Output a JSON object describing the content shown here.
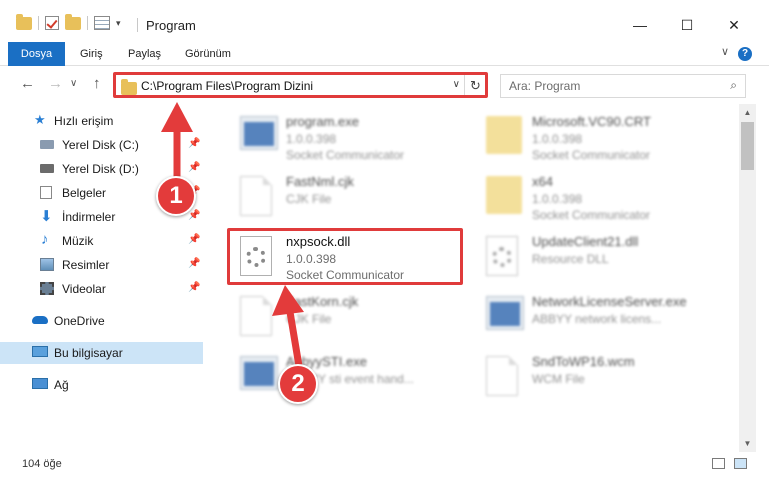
{
  "window": {
    "title": "Program",
    "minimize": "—",
    "maximize": "☐",
    "close": "✕"
  },
  "ribbon": {
    "tabs": [
      "Dosya",
      "Giriş",
      "Paylaş",
      "Görünüm"
    ],
    "help": "?",
    "expand": "∨"
  },
  "nav": {
    "back": "←",
    "forward": "→",
    "up": "↑",
    "recent": "∨",
    "address": "C:\\Program Files\\Program Dizini",
    "address_dropdown": "∨",
    "refresh": "↻",
    "search_placeholder": "Ara: Program",
    "search_icon": "⌕"
  },
  "sidebar": {
    "items": [
      {
        "label": "Hızlı erişim",
        "icon": "star-icon"
      },
      {
        "label": "Yerel Disk (C:)",
        "icon": "drive-icon",
        "pinned": true
      },
      {
        "label": "Yerel Disk (D:)",
        "icon": "drive-icon",
        "pinned": true
      },
      {
        "label": "Belgeler",
        "icon": "documents-icon",
        "pinned": true
      },
      {
        "label": "İndirmeler",
        "icon": "download-icon",
        "pinned": true
      },
      {
        "label": "Müzik",
        "icon": "music-icon",
        "pinned": true
      },
      {
        "label": "Resimler",
        "icon": "pictures-icon",
        "pinned": true
      },
      {
        "label": "Videolar",
        "icon": "videos-icon",
        "pinned": true
      },
      {
        "label": "OneDrive",
        "icon": "cloud-icon"
      },
      {
        "label": "Bu bilgisayar",
        "icon": "computer-icon",
        "selected": true
      },
      {
        "label": "Ağ",
        "icon": "network-icon"
      }
    ],
    "pin_glyph": "📌"
  },
  "files": [
    {
      "name": "program.exe",
      "line1": "1.0.0.398",
      "line2": "Socket Communicator",
      "icon": "exe-icon"
    },
    {
      "name": "Microsoft.VC90.CRT",
      "line1": "1.0.0.398",
      "line2": "Socket Communicator",
      "icon": "folder-icon"
    },
    {
      "name": "FastNml.cjk",
      "line1": "CJK File",
      "line2": "",
      "icon": "document-icon"
    },
    {
      "name": "x64",
      "line1": "1.0.0.398",
      "line2": "Socket Communicator",
      "icon": "folder-icon"
    },
    {
      "name": "nxpsock.dll",
      "line1": "1.0.0.398",
      "line2": "Socket Communicator",
      "icon": "dll-gear-icon",
      "highlighted": true
    },
    {
      "name": "UpdateClient21.dll",
      "line1": "Resource DLL",
      "line2": "",
      "icon": "dll-gear-icon"
    },
    {
      "name": "FastKorn.cjk",
      "line1": "CJK File",
      "line2": "",
      "icon": "document-icon"
    },
    {
      "name": "NetworkLicenseServer.exe",
      "line1": "ABBYY network licens...",
      "line2": "",
      "icon": "exe-icon"
    },
    {
      "name": "AbbyySTI.exe",
      "line1": "ABBYY sti event hand...",
      "line2": "",
      "icon": "exe-icon"
    },
    {
      "name": "SndToWP16.wcm",
      "line1": "WCM File",
      "line2": "",
      "icon": "document-icon"
    }
  ],
  "status": {
    "count": "104 öğe"
  },
  "annotations": {
    "badge1": "1",
    "badge2": "2",
    "color": "#e33b3b"
  },
  "colors": {
    "file_tab": "#1a6fc4",
    "selection": "#cce4f7",
    "highlight_box": "#e03b3b"
  }
}
